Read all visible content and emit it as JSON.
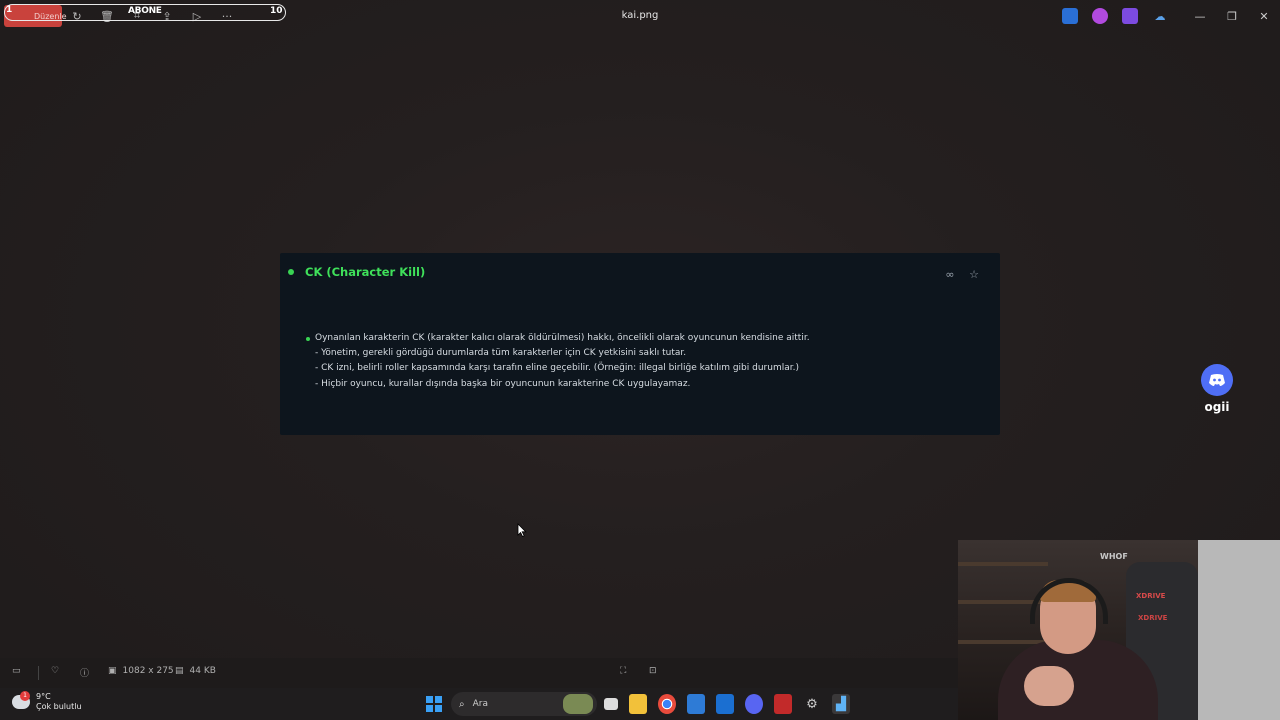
{
  "window": {
    "title": "kai.png",
    "edit_label": "Düzenle"
  },
  "overlay": {
    "left_number": "1",
    "center_text": "ABONE",
    "right_number": "10"
  },
  "card": {
    "title": "CK (Character Kill)",
    "rules": [
      "Oynanılan karakterin CK (karakter kalıcı olarak öldürülmesi) hakkı, öncelikli olarak oyuncunun kendisine aittir.",
      "- Yönetim, gerekli gördüğü durumlarda tüm karakterler için CK yetkisini saklı tutar.",
      "- CK izni, belirli roller kapsamında karşı tarafın eline geçebilir. (Örneğin: illegal birliğe katılım gibi durumlar.)",
      "- Hiçbir oyuncu, kurallar dışında başka bir oyuncunun karakterine CK uygulayamaz."
    ]
  },
  "discord": {
    "name": "ogii"
  },
  "viewer_bar": {
    "dimensions": "1082 x 275",
    "file_size": "44 KB"
  },
  "webcam": {
    "sign_text": "WHOF",
    "chair_brand": "XDRIVE"
  },
  "taskbar": {
    "temperature": "9°C",
    "weather_desc": "Çok bulutlu",
    "weather_badge": "1",
    "search_placeholder": "Ara"
  },
  "colors": {
    "accent_green": "#3fe05a",
    "card_bg": "#0d151d",
    "edit_red": "#c9423c",
    "discord_blue": "#4f6ef5"
  }
}
